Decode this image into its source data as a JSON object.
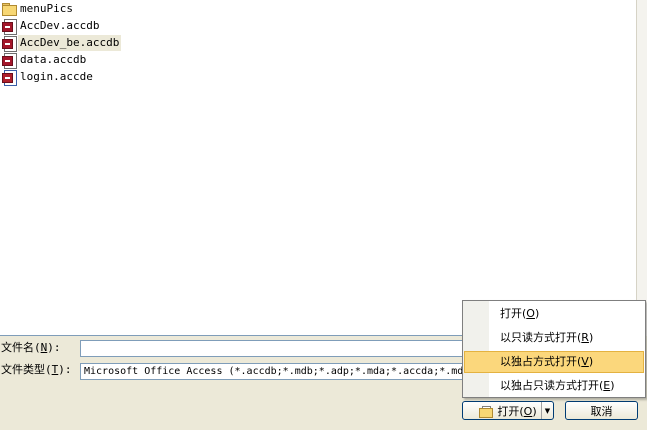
{
  "files": [
    {
      "name": "menuPics",
      "type": "folder-icon",
      "selected": false
    },
    {
      "name": "AccDev.accdb",
      "type": "access-db-icon",
      "selected": false
    },
    {
      "name": "AccDev_be.accdb",
      "type": "access-db-icon",
      "selected": true
    },
    {
      "name": "data.accdb",
      "type": "access-db-icon",
      "selected": false
    },
    {
      "name": "login.accde",
      "type": "access-locked-db-icon",
      "selected": false
    }
  ],
  "filename_field": {
    "label": "文件名",
    "hotkey": "N",
    "value": ""
  },
  "filetype_field": {
    "label": "文件类型",
    "hotkey": "T",
    "value": "Microsoft Office Access (*.accdb;*.mdb;*.adp;*.mda;*.accda;*.mde"
  },
  "open_button": {
    "label": "打开",
    "hotkey": "O",
    "icon": "open-folder-icon"
  },
  "cancel_button": {
    "label": "取消"
  },
  "open_menu": [
    {
      "label": "打开",
      "hotkey": "O",
      "hover": false
    },
    {
      "label": "以只读方式打开",
      "hotkey": "R",
      "hover": false
    },
    {
      "label": "以独占方式打开",
      "hotkey": "V",
      "hover": true
    },
    {
      "label": "以独占只读方式打开",
      "hotkey": "E",
      "hover": false
    }
  ]
}
